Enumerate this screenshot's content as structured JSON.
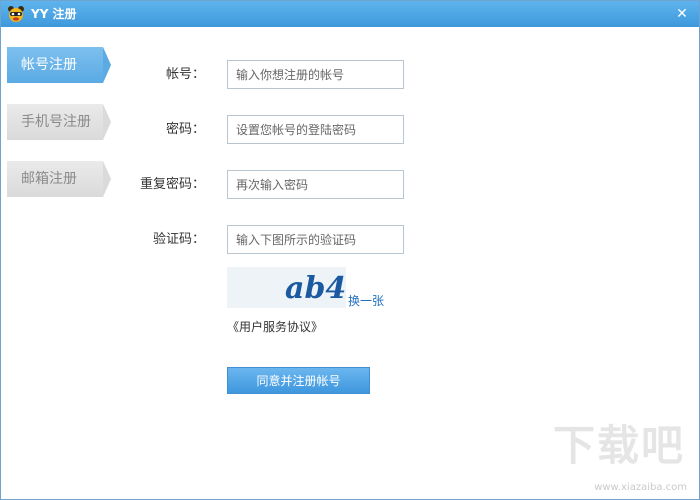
{
  "window": {
    "title": "YY 注册",
    "close_glyph": "✕",
    "app_icon": "yy-bear-icon"
  },
  "tabs": [
    {
      "label": "帐号注册",
      "active": true
    },
    {
      "label": "手机号注册",
      "active": false
    },
    {
      "label": "邮箱注册",
      "active": false
    }
  ],
  "form": {
    "account": {
      "label": "帐号：",
      "placeholder": "输入你想注册的帐号",
      "value": ""
    },
    "password": {
      "label": "密码：",
      "placeholder": "设置您帐号的登陆密码",
      "value": ""
    },
    "repeat_password": {
      "label": "重复密码：",
      "placeholder": "再次输入密码",
      "value": ""
    },
    "captcha": {
      "label": "验证码：",
      "placeholder": "输入下图所示的验证码",
      "value": ""
    },
    "captcha_image_text": "ab4",
    "refresh_label": "换一张",
    "agreement_label": "《用户服务协议》",
    "submit_label": "同意并注册帐号"
  },
  "watermark": {
    "text": "下载吧",
    "url": "www.xiazaiba.com"
  },
  "colors": {
    "titlebar": "#3d98dc",
    "tab_active": "#5aaae4",
    "tab_inactive": "#dadada",
    "button": "#3e97dd",
    "link": "#1f6fbf"
  }
}
